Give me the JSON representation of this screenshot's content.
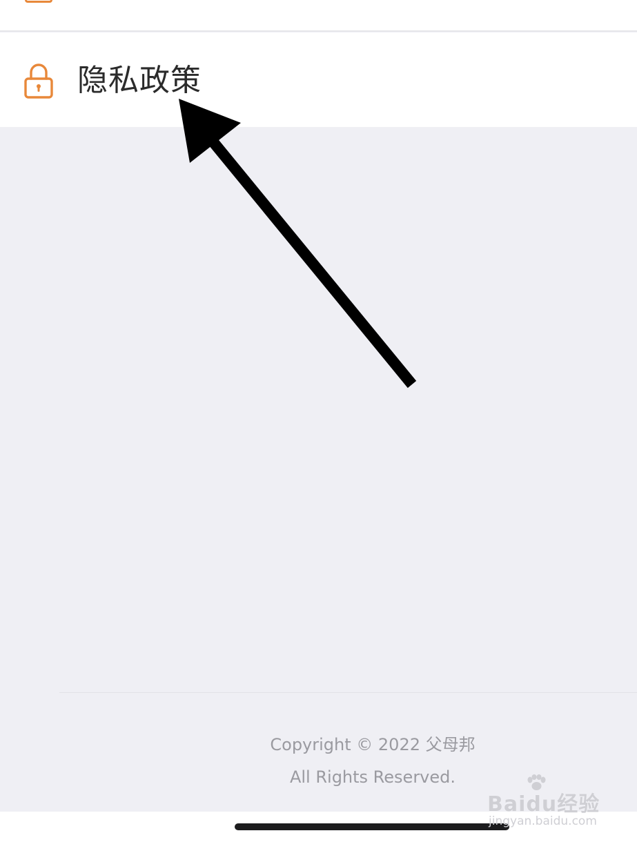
{
  "settings": {
    "privacy_item": {
      "label": "隐私政策",
      "icon": "lock-icon",
      "icon_color": "#e8883a"
    }
  },
  "footer": {
    "copyright": "Copyright © 2022 父母邦",
    "rights": "All Rights Reserved."
  },
  "watermark": {
    "brand": "Baidu经验",
    "url": "jingyan.baidu.com"
  },
  "colors": {
    "background": "#efeff4",
    "row_background": "#ffffff",
    "accent": "#e8883a",
    "footer_text": "#9a9aa0"
  }
}
